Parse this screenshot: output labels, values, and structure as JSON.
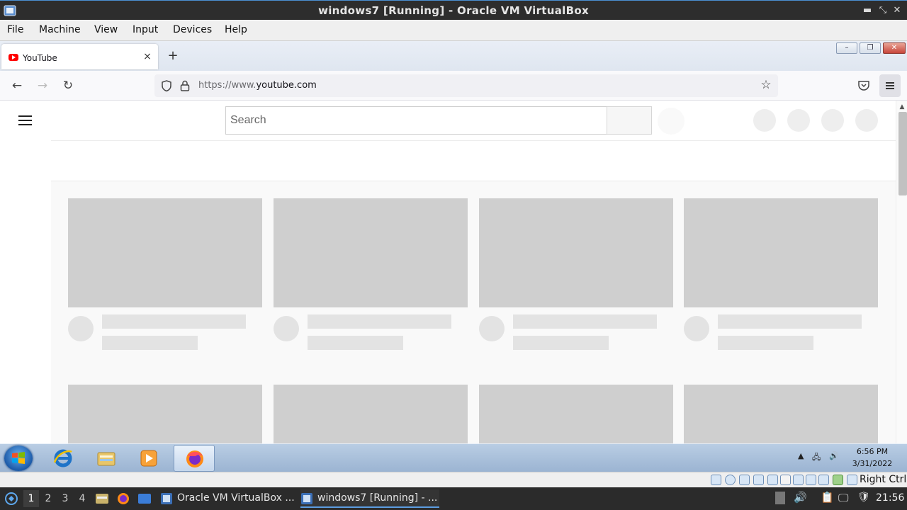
{
  "vbox": {
    "title": "windows7 [Running] - Oracle VM VirtualBox",
    "menu": [
      "File",
      "Machine",
      "View",
      "Input",
      "Devices",
      "Help"
    ],
    "status_right": "Right Ctrl"
  },
  "firefox": {
    "tab": {
      "label": "YouTube",
      "close": "×"
    },
    "new_tab": "+",
    "url_prefix": "https://www.",
    "url_domain": "youtube.com",
    "window_buttons": {
      "minimize": "–",
      "maximize": "❐",
      "close": "✕"
    }
  },
  "youtube": {
    "search_placeholder": "Search",
    "skeleton_cards": 8
  },
  "win7_taskbar": {
    "clock_time": "6:56 PM",
    "clock_date": "3/31/2022",
    "pinned": [
      "internet-explorer",
      "windows-explorer",
      "media-player",
      "firefox"
    ]
  },
  "host_panel": {
    "workspaces": [
      "1",
      "2",
      "3",
      "4"
    ],
    "tasks": [
      "Oracle VM VirtualBox ...",
      "windows7 [Running] - ..."
    ],
    "time": "21:56"
  },
  "colors": {
    "youtube_red": "#ff0000",
    "skeleton": "#cfcfcf",
    "win7_taskbar": "#b9cde4"
  }
}
